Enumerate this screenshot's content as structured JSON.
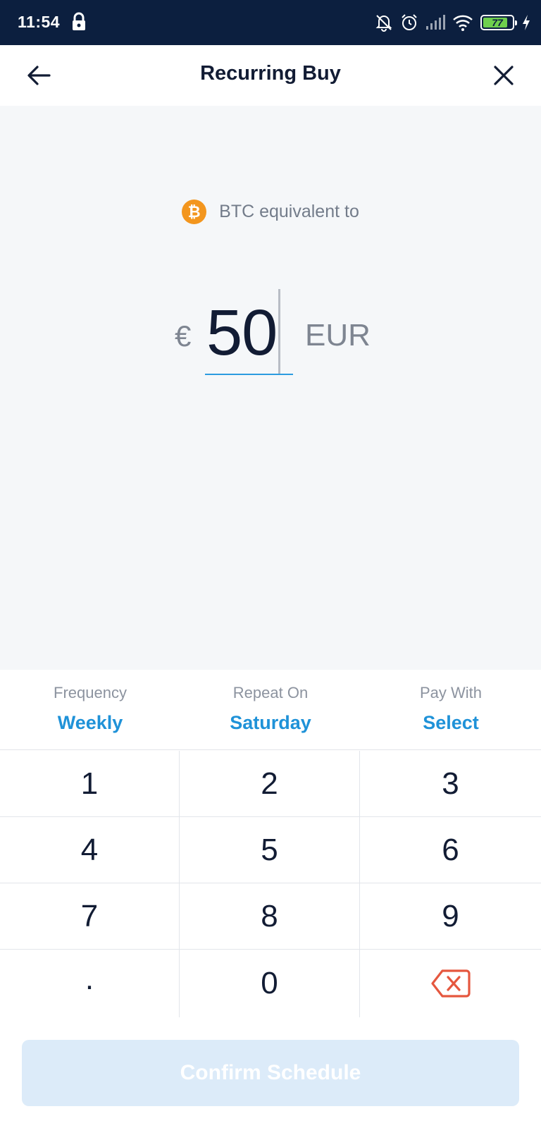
{
  "status_bar": {
    "time": "11:54",
    "battery_level": "77",
    "icons": [
      "lock-icon",
      "notifications-off-icon",
      "alarm-icon",
      "signal-icon",
      "wifi-icon",
      "battery-icon",
      "charging-icon"
    ]
  },
  "header": {
    "title": "Recurring Buy",
    "back_icon": "arrow-left-icon",
    "close_icon": "close-icon"
  },
  "amount": {
    "asset_icon_symbol": "₿",
    "asset_label": "BTC equivalent to",
    "currency_symbol": "€",
    "value": "50",
    "currency_code": "EUR"
  },
  "options": {
    "frequency": {
      "label": "Frequency",
      "value": "Weekly"
    },
    "repeat_on": {
      "label": "Repeat On",
      "value": "Saturday"
    },
    "pay_with": {
      "label": "Pay With",
      "value": "Select"
    }
  },
  "keypad": {
    "keys": [
      "1",
      "2",
      "3",
      "4",
      "5",
      "6",
      "7",
      "8",
      "9",
      ".",
      "0"
    ],
    "backspace_icon": "backspace-icon"
  },
  "confirm_button": {
    "label": "Confirm Schedule"
  },
  "colors": {
    "status_bar_bg": "#0c1f3f",
    "accent_blue": "#1f92d8",
    "btc_orange": "#f3961e",
    "backspace_red": "#e5573f",
    "confirm_disabled_bg": "#dcebf9"
  }
}
